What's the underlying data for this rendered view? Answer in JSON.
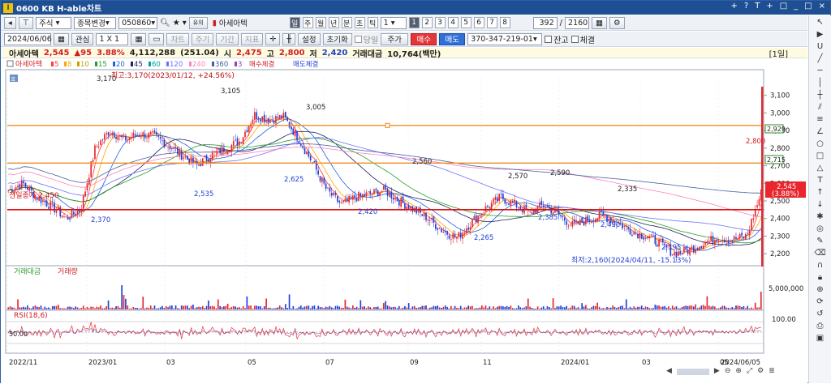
{
  "window": {
    "title": "0600 KB H-able차트",
    "controls": [
      "+",
      "?",
      "T",
      "+",
      "□",
      "_",
      "□",
      "×"
    ]
  },
  "toolbar1": {
    "type_label": "주식",
    "change_label": "종목변경",
    "code": "050860",
    "stock_name": "아세아텍",
    "periods": [
      "일",
      "주",
      "월",
      "년",
      "분",
      "초",
      "틱"
    ],
    "period_value": "1",
    "pages": [
      "1",
      "2",
      "3",
      "4",
      "5",
      "6",
      "7",
      "8"
    ],
    "count_value": "392",
    "total_value": "2160"
  },
  "toolbar2": {
    "date": "2024/06/06",
    "watch_label": "관심",
    "ratio_label": "1 X 1",
    "disabled": [
      "차트",
      "주기",
      "기간",
      "지표"
    ],
    "settings_label": "설정",
    "reset_label": "초기화",
    "sameday_label": "당일",
    "price_label": "주가",
    "buy_label": "매수",
    "sell_label": "매도",
    "account": "370-347-219-01",
    "balance_label": "잔고",
    "filled_label": "체결"
  },
  "ticker": {
    "name": "아세아텍",
    "price": "2,545",
    "change": "▲95",
    "rate": "3.88%",
    "volume": "4,112,288",
    "vol_ratio": "(251.04)",
    "open_label": "시",
    "open": "2,475",
    "high_label": "고",
    "high": "2,800",
    "low_label": "저",
    "low": "2,420",
    "amount_label": "거래대금",
    "amount": "10,764(백만)",
    "period_badge": "[1일]"
  },
  "legend": {
    "name": "아세아텍",
    "ma": [
      {
        "label": "5",
        "color": "#ff3b3b"
      },
      {
        "label": "8",
        "color": "#ffa500"
      },
      {
        "label": "10",
        "color": "#c8a000"
      },
      {
        "label": "15",
        "color": "#22a022"
      },
      {
        "label": "20",
        "color": "#2060e0"
      },
      {
        "label": "45",
        "color": "#202060"
      },
      {
        "label": "60",
        "color": "#00a0a0"
      },
      {
        "label": "120",
        "color": "#7070ff"
      },
      {
        "label": "240",
        "color": "#ff80c0"
      },
      {
        "label": "360",
        "color": "#4060a0"
      },
      {
        "label": "3",
        "color": "#9040c0"
      }
    ],
    "buy_fill": "매수체결",
    "sell_fill": "매도체결",
    "volume_legend": [
      "거래대금",
      "거래량"
    ],
    "rsi_legend": "RSI(18,6)"
  },
  "annotations": {
    "high_note": "최고:3,170(2023/01/12, +24.56%)",
    "low_note": "최저:2,160(2024/04/11, -15.13%)",
    "prev_close": "전일종가 2,450"
  },
  "price_axis": [
    "3,100",
    "3,000",
    "2,900",
    "2,800",
    "2,700",
    "2,600",
    "2,500",
    "2,400",
    "2,300",
    "2,200"
  ],
  "price_tags": {
    "h1": "2,929",
    "h2": "2,715",
    "cur": "2,545",
    "cur_rate": "(3.88%)"
  },
  "volume_axis": "5,000,000",
  "rsi_axis": {
    "top": "100.00",
    "mid": "50.00"
  },
  "date_axis": [
    "2022/11",
    "2023/01",
    "03",
    "05",
    "07",
    "09",
    "11",
    "2024/01",
    "03",
    "05",
    "2024/06/05"
  ],
  "colors": {
    "up": "#e8262b",
    "down": "#1f3fd8",
    "orange": "#f08c1e",
    "prev_line": "#e01010"
  },
  "chart_data": {
    "type": "candlestick",
    "title": "아세아텍",
    "y_range": [
      2150,
      3200
    ],
    "labeled_points": [
      {
        "label": "3,170",
        "value": 3170,
        "date": "2023/01/12"
      },
      {
        "label": "3,105",
        "value": 3105
      },
      {
        "label": "3,005",
        "value": 3005
      },
      {
        "label": "2,625",
        "value": 2625
      },
      {
        "label": "2,535",
        "value": 2535
      },
      {
        "label": "2,370",
        "value": 2370
      },
      {
        "label": "2,420",
        "value": 2420
      },
      {
        "label": "2,560",
        "value": 2560
      },
      {
        "label": "2,265",
        "value": 2265
      },
      {
        "label": "2,570",
        "value": 2570
      },
      {
        "label": "2,590",
        "value": 2590
      },
      {
        "label": "2,385",
        "value": 2385
      },
      {
        "label": "2,490",
        "value": 2490
      },
      {
        "label": "2,335",
        "value": 2335
      },
      {
        "label": "2,195",
        "value": 2195
      },
      {
        "label": "2,800",
        "value": 2800
      }
    ],
    "horizontal_lines": [
      2929,
      2715,
      2450
    ],
    "close_path": [
      2560,
      2600,
      2520,
      2470,
      2400,
      2450,
      2800,
      2900,
      2850,
      2880,
      2870,
      2820,
      2760,
      2700,
      2760,
      2800,
      2840,
      2990,
      2960,
      2980,
      2860,
      2720,
      2560,
      2480,
      2520,
      2540,
      2560,
      2500,
      2450,
      2400,
      2330,
      2290,
      2380,
      2460,
      2520,
      2480,
      2430,
      2480,
      2420,
      2360,
      2390,
      2420,
      2380,
      2330,
      2300,
      2260,
      2200,
      2220,
      2260,
      2290,
      2280,
      2300,
      2545
    ]
  }
}
